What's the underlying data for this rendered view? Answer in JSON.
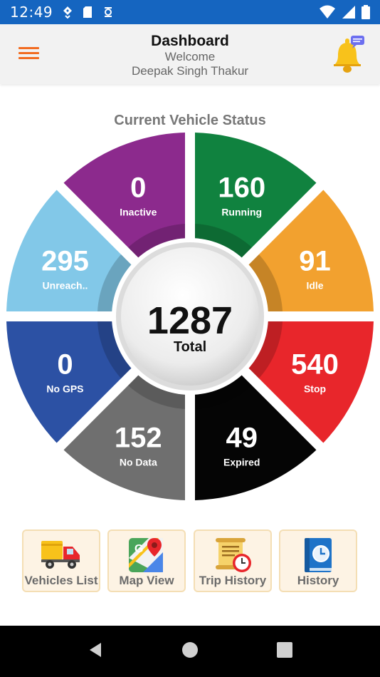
{
  "status_bar": {
    "time": "12:49"
  },
  "header": {
    "title": "Dashboard",
    "welcome": "Welcome",
    "user_name": "Deepak Singh Thakur"
  },
  "gauge": {
    "title": "Current Vehicle Status",
    "total_value": "1287",
    "total_label": "Total",
    "segments": [
      {
        "key": "running",
        "value": "160",
        "label": "Running",
        "color": "#10823f"
      },
      {
        "key": "idle",
        "value": "91",
        "label": "Idle",
        "color": "#f2a12f"
      },
      {
        "key": "stop",
        "value": "540",
        "label": "Stop",
        "color": "#e8262b"
      },
      {
        "key": "expired",
        "value": "49",
        "label": "Expired",
        "color": "#050505"
      },
      {
        "key": "no-data",
        "value": "152",
        "label": "No Data",
        "color": "#6f6f6f"
      },
      {
        "key": "no-gps",
        "value": "0",
        "label": "No GPS",
        "color": "#2c51a4"
      },
      {
        "key": "unreach",
        "value": "295",
        "label": "Unreach..",
        "color": "#82c8e8"
      },
      {
        "key": "inactive",
        "value": "0",
        "label": "Inactive",
        "color": "#8c2a8d"
      }
    ]
  },
  "shortcuts": [
    {
      "key": "vehicles-list",
      "label": "Vehicles List"
    },
    {
      "key": "map-view",
      "label": "Map View"
    },
    {
      "key": "trip-history",
      "label": "Trip History"
    },
    {
      "key": "history",
      "label": "History"
    }
  ],
  "colors": {
    "status_bar": "#1565c0",
    "accent": "#f26c21",
    "shortcut_bg": "#fdf3e4"
  }
}
